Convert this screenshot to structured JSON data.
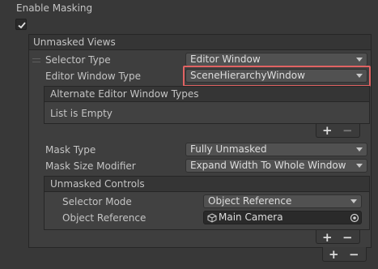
{
  "enable_masking": {
    "label": "Enable Masking",
    "checked": true
  },
  "unmasked_views": {
    "header": "Unmasked Views",
    "selector_type": {
      "label": "Selector Type",
      "value": "Editor Window"
    },
    "editor_window_type": {
      "label": "Editor Window Type",
      "value": "SceneHierarchyWindow"
    },
    "alternate_types": {
      "header": "Alternate Editor Window Types",
      "empty_text": "List is Empty"
    },
    "mask_type": {
      "label": "Mask Type",
      "value": "Fully Unmasked"
    },
    "mask_size_modifier": {
      "label": "Mask Size Modifier",
      "value": "Expand Width To Whole Window"
    },
    "unmasked_controls": {
      "header": "Unmasked Controls",
      "selector_mode": {
        "label": "Selector Mode",
        "value": "Object Reference"
      },
      "object_reference": {
        "label": "Object Reference",
        "value": "Main Camera"
      }
    }
  },
  "footer_buttons": {
    "plus": "+",
    "minus": "−"
  },
  "colors": {
    "highlight": "#e06363",
    "background": "#383838"
  }
}
